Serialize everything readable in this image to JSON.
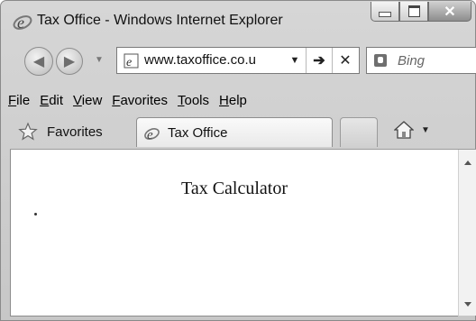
{
  "window": {
    "title": "Tax Office - Windows Internet Explorer"
  },
  "address_bar": {
    "url": "www.taxoffice.co.u"
  },
  "search": {
    "placeholder": "Bing"
  },
  "menu": [
    "File",
    "Edit",
    "View",
    "Favorites",
    "Tools",
    "Help"
  ],
  "favorites_bar": {
    "favorites_label": "Favorites"
  },
  "tabs": [
    {
      "label": "Tax Office"
    }
  ],
  "page": {
    "heading": "Tax Calculator"
  },
  "colors": {
    "chrome": "#d0d0d0",
    "content_bg": "#ffffff",
    "border": "#8a8a8a"
  },
  "icons": {
    "app": "ie-logo-icon",
    "back": "back-arrow-icon",
    "forward": "forward-arrow-icon",
    "go": "go-arrow-icon",
    "stop": "stop-x-icon",
    "search_provider": "bing-icon",
    "favorites": "star-icon",
    "home": "home-icon"
  }
}
